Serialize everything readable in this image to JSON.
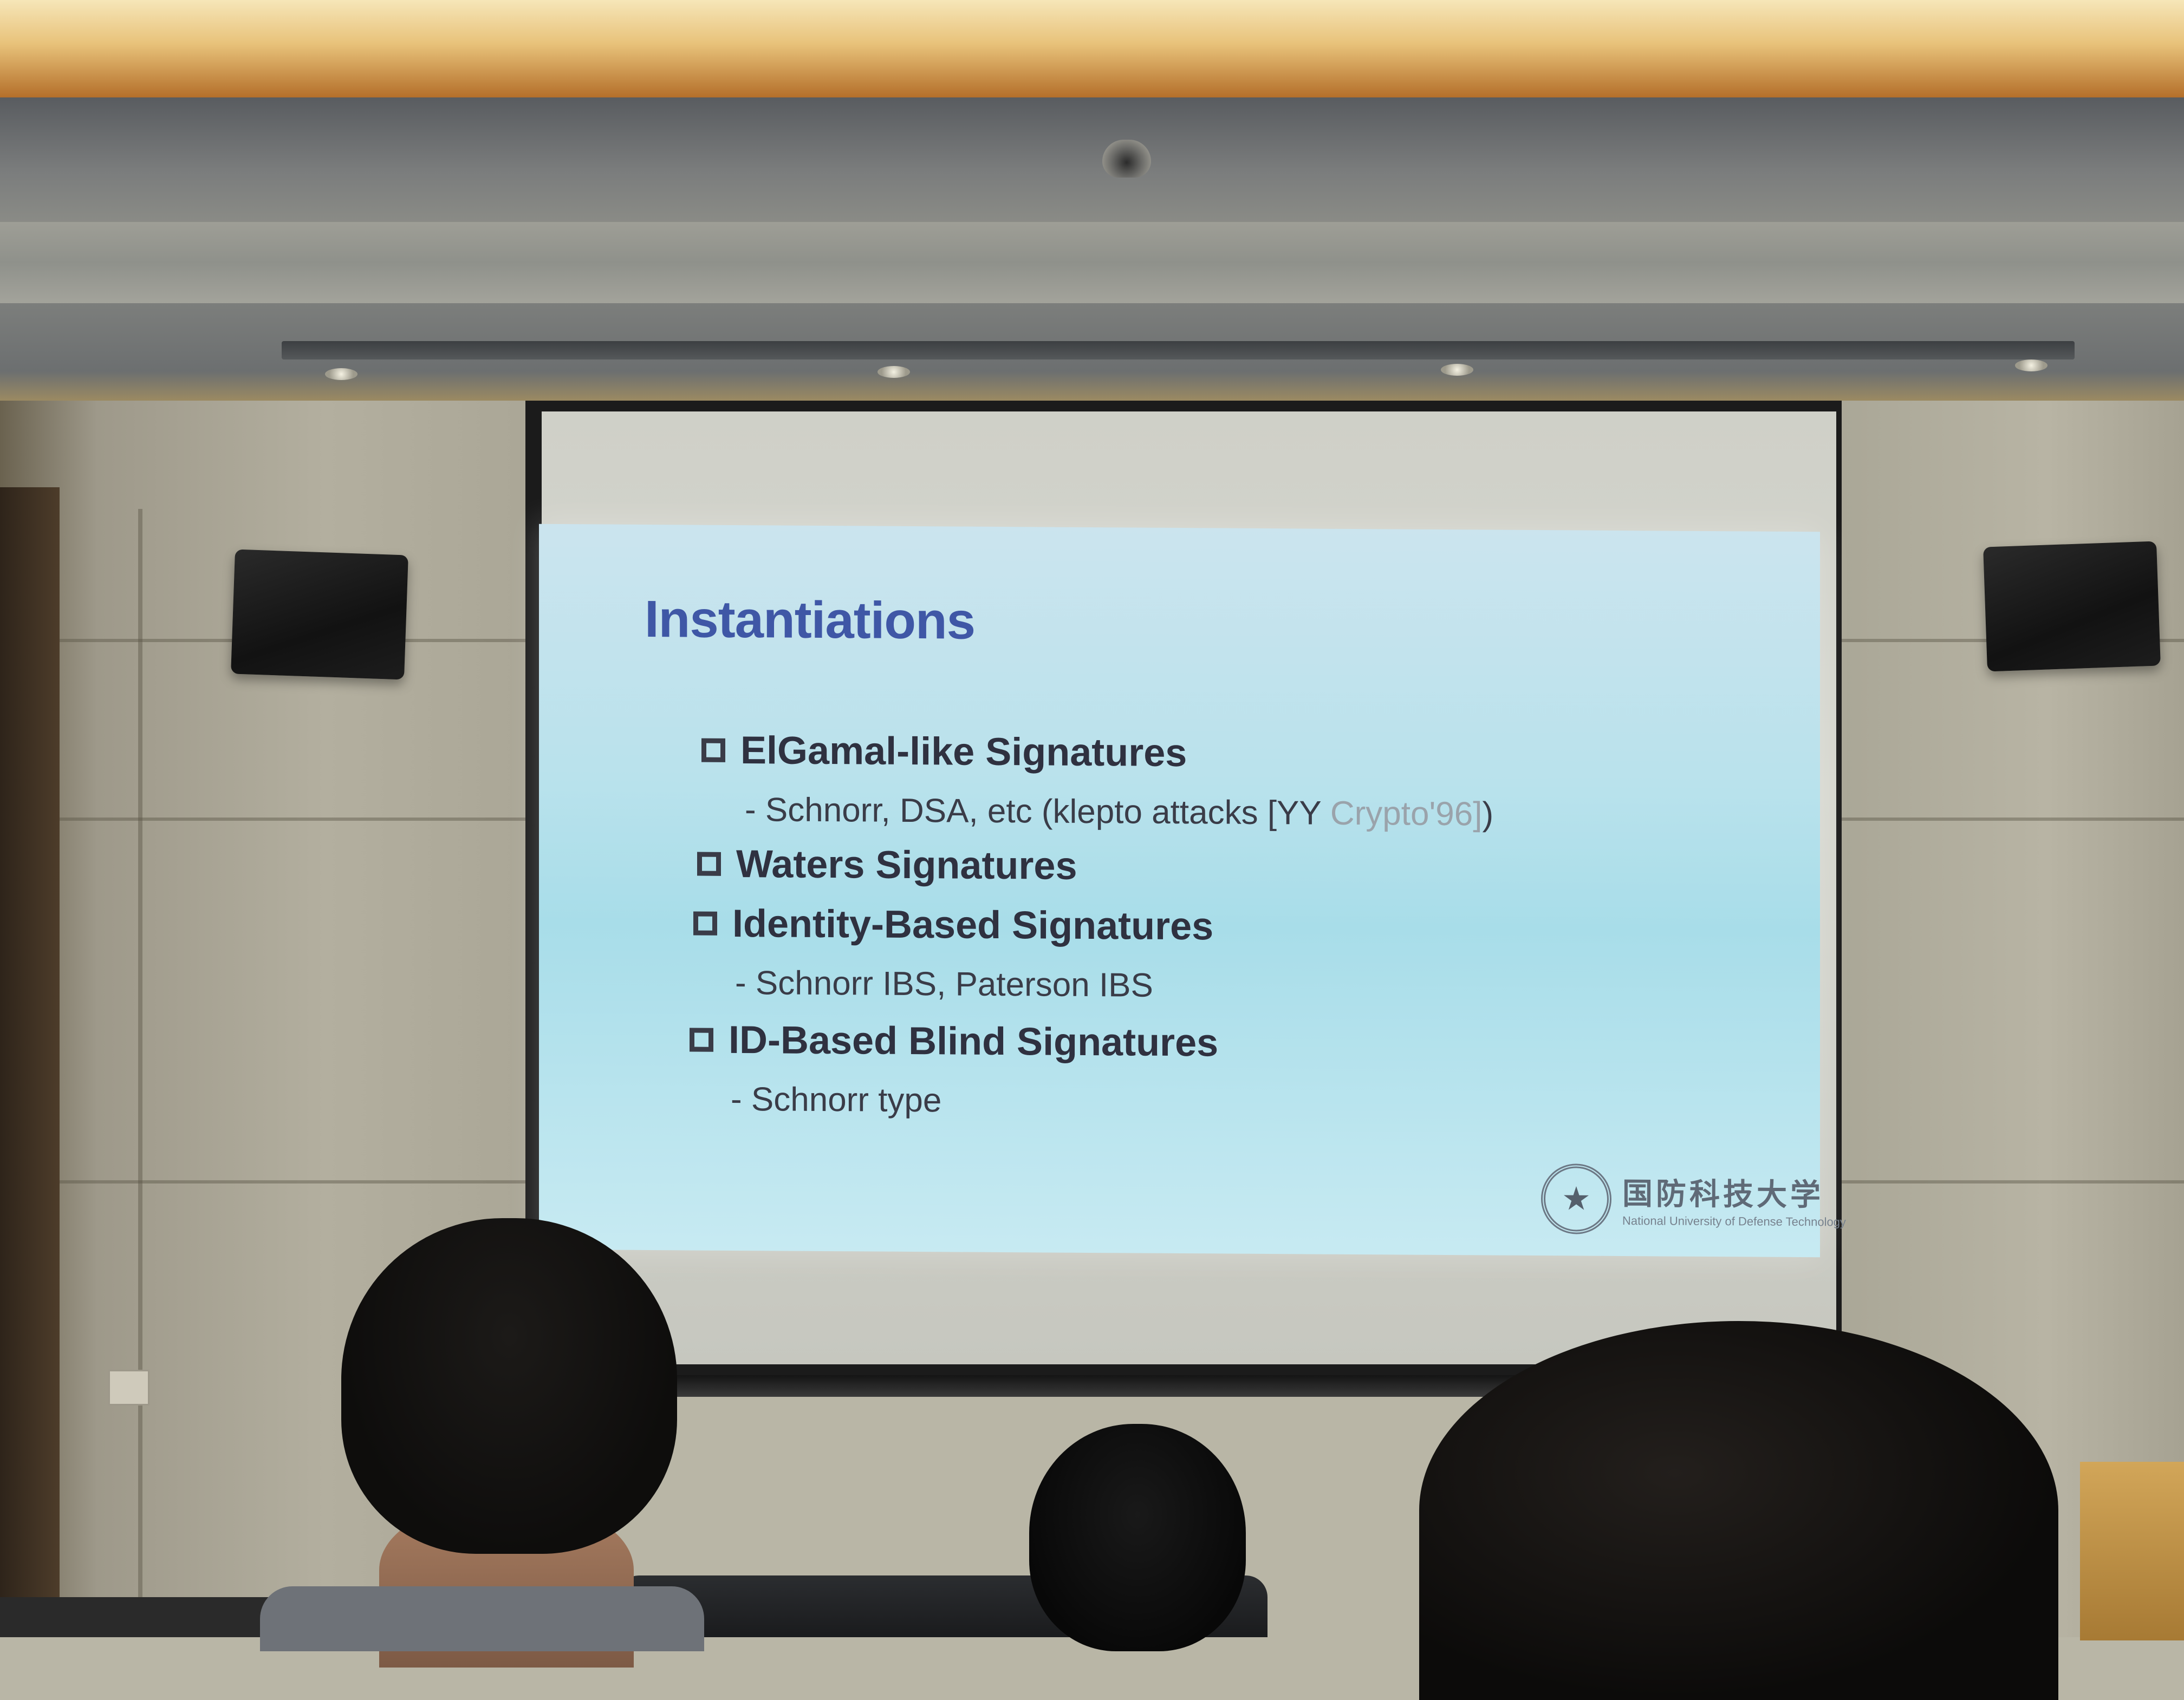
{
  "slide": {
    "title": "Instantiations",
    "items": [
      {
        "label": "ElGamal-like Signatures",
        "sub": "- Schnorr, DSA, etc (klepto attacks [YY ",
        "sub_faint": "Crypto'96]",
        "sub_tail": ")"
      },
      {
        "label": "Waters Signatures"
      },
      {
        "label": "Identity-Based Signatures",
        "sub": "- Schnorr IBS, Paterson IBS"
      },
      {
        "label": "ID-Based Blind Signatures",
        "sub": "- Schnorr type"
      }
    ],
    "logo": {
      "name": "国防科技大学",
      "subtitle": "National University of Defense Technology",
      "emblem": "star-emblem-icon"
    }
  },
  "colors": {
    "title": "#3f57a6",
    "slide_bg": "#b9e2ec",
    "text": "#2f3140"
  }
}
